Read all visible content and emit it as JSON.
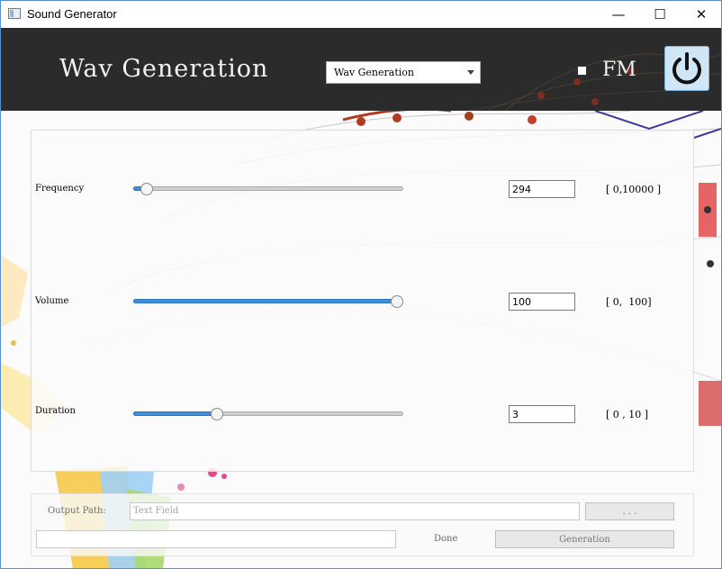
{
  "window": {
    "title": "Sound Generator",
    "minimize": "—",
    "maximize": "☐",
    "close": "✕"
  },
  "header": {
    "title": "Wav Generation",
    "mode_select": {
      "value": "Wav Generation"
    },
    "fm_checkbox": {
      "label": "FM",
      "checked": false
    },
    "power_icon": "power-icon"
  },
  "params": {
    "frequency": {
      "label": "Frequency",
      "value": "294",
      "range": "[ 0,10000 ]",
      "level": 0.029
    },
    "volume": {
      "label": "Volume",
      "value": "100",
      "range": "[ 0,  100]",
      "level": 1.0
    },
    "duration": {
      "label": "Duration",
      "value": "3",
      "range": "[ 0 , 10 ]",
      "level": 0.3
    }
  },
  "output": {
    "label": "Output Path:",
    "path_placeholder": "Text Field",
    "browse_label": ". . .",
    "progress": 0,
    "status": "Done",
    "generate_label": "Generation"
  },
  "colors": {
    "header_bg": "#2b2b2b",
    "slider_fill": "#3f90dc",
    "accent_border": "#5a8fd0"
  }
}
